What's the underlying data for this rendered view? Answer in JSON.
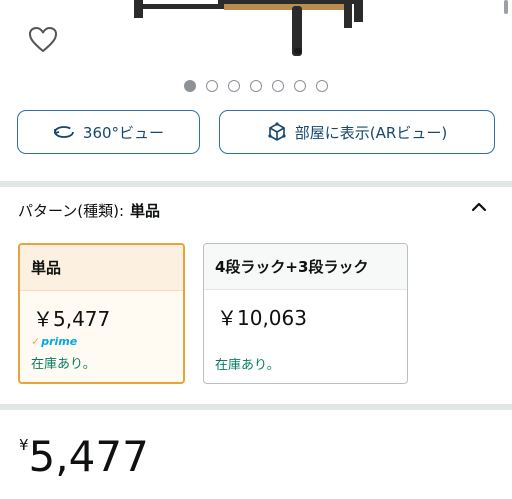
{
  "product": {
    "image_dots_count": 7,
    "image_dots_active_index": 0
  },
  "view_buttons": {
    "view_360_label": "360°ビュー",
    "ar_view_label": "部屋に表示(ARビュー)"
  },
  "pattern": {
    "label": "パターン(種類):",
    "selected": "単品",
    "options": [
      {
        "name": "単品",
        "price": "￥5,477",
        "prime": "prime",
        "stock": "在庫あり。",
        "selected": true
      },
      {
        "name": "4段ラック+3段ラック",
        "price": "￥10,063",
        "stock": "在庫あり。",
        "selected": false
      }
    ]
  },
  "price": {
    "currency_symbol": "¥",
    "amount": "5,477"
  },
  "colors": {
    "accent_border": "#e8a33a",
    "button_border": "#2e6fae",
    "stock_green": "#067d62",
    "prime_blue": "#00a8e1"
  },
  "icons": [
    "heart-icon",
    "rotate-360-icon",
    "ar-cube-icon",
    "chevron-up-icon"
  ]
}
